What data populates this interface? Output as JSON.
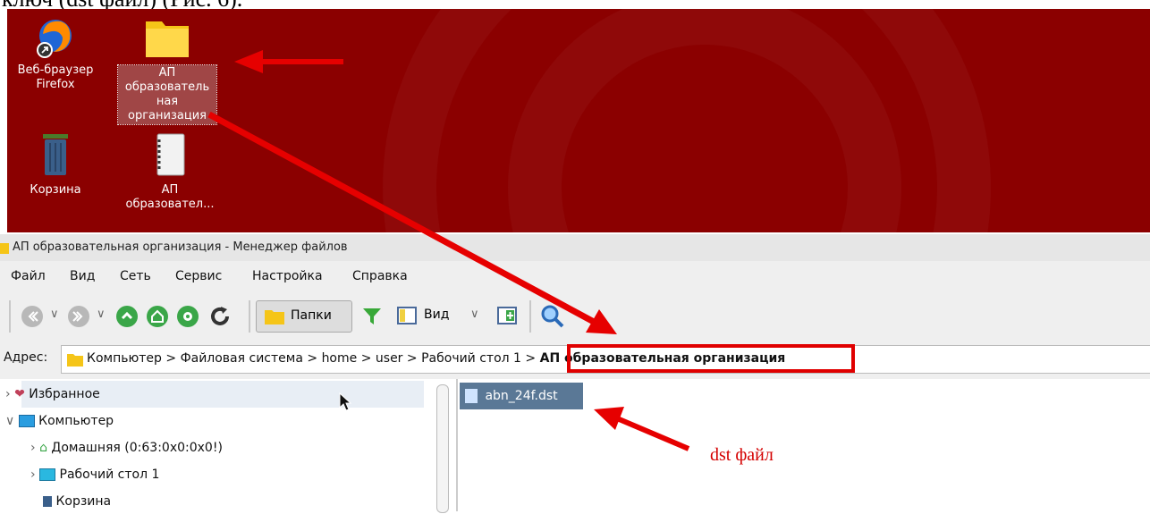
{
  "doc": {
    "caption": "ключ (dst файл) (Рис. 6)."
  },
  "desktop": {
    "icons": [
      {
        "label_l1": "Веб-браузер",
        "label_l2": "Firefox"
      },
      {
        "label_l1": "АП",
        "label_l2": "образователь",
        "label_l3": "ная",
        "label_l4": "организация"
      },
      {
        "label_l1": "Корзина"
      },
      {
        "label_l1": "АП",
        "label_l2": "образовател..."
      }
    ]
  },
  "window": {
    "title": "АП образовательная организация - Менеджер файлов",
    "menu": [
      "Файл",
      "Вид",
      "Сеть",
      "Сервис",
      "Настройка",
      "Справка"
    ],
    "toolbar": {
      "folders_label": "Папки",
      "view_label": "Вид"
    },
    "address": {
      "label": "Адрес:",
      "crumbs": [
        "Компьютер",
        "Файловая система",
        "home",
        "user",
        "Рабочий стол 1"
      ],
      "current": "АП образовательная организация"
    },
    "tree": [
      {
        "label": "Избранное"
      },
      {
        "label": "Компьютер"
      },
      {
        "label": "Домашняя (0:63:0x0:0x0!)"
      },
      {
        "label": "Рабочий стол 1"
      },
      {
        "label": "Корзина"
      }
    ],
    "files": [
      {
        "name": "abn_24f.dst"
      }
    ]
  },
  "annotation": {
    "dst_note": "dst файл"
  },
  "colors": {
    "desktop_bg": "#8b0000",
    "arrow": "#e60000",
    "selection": "#5a7896"
  }
}
